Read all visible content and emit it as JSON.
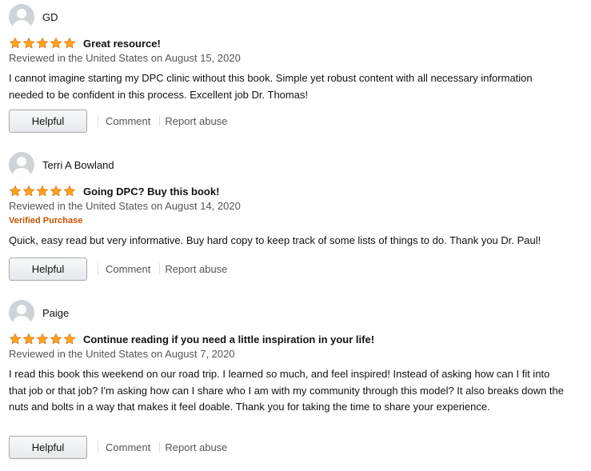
{
  "colors": {
    "star": "#ffa41c",
    "star_outline": "#de7921",
    "verified": "#c45500",
    "meta_text": "#555555"
  },
  "icons": {
    "avatar": "default-user-avatar",
    "rating": "star"
  },
  "reviews": [
    {
      "reviewer": "GD",
      "rating": 5,
      "title": "Great resource!",
      "meta": "Reviewed in the United States on August 15, 2020",
      "verified": "",
      "body": "I cannot imagine starting my DPC clinic without this book. Simple yet robust content with all necessary information needed to be confident in this process. Excellent job Dr. Thomas!",
      "helpful_label": "Helpful",
      "comment_label": "Comment",
      "report_label": "Report abuse"
    },
    {
      "reviewer": "Terri A Bowland",
      "rating": 5,
      "title": "Going DPC? Buy this book!",
      "meta": "Reviewed in the United States on August 14, 2020",
      "verified": "Verified Purchase",
      "body": "Quick, easy read but very informative. Buy hard copy to keep track of some lists of things to do. Thank you Dr. Paul!",
      "helpful_label": "Helpful",
      "comment_label": "Comment",
      "report_label": "Report abuse"
    },
    {
      "reviewer": "Paige",
      "rating": 5,
      "title": "Continue reading if you need a little inspiration in your life!",
      "meta": "Reviewed in the United States on August 7, 2020",
      "verified": "",
      "body": "I read this book this weekend on our road trip. I learned so much, and feel inspired! Instead of asking how can I fit into that job or that job? I'm asking how can I share who I am with my community through this model? It also breaks down the nuts and bolts in a way that makes it feel doable. Thank you for taking the time to share your experience.",
      "helpful_label": "Helpful",
      "comment_label": "Comment",
      "report_label": "Report abuse"
    }
  ]
}
